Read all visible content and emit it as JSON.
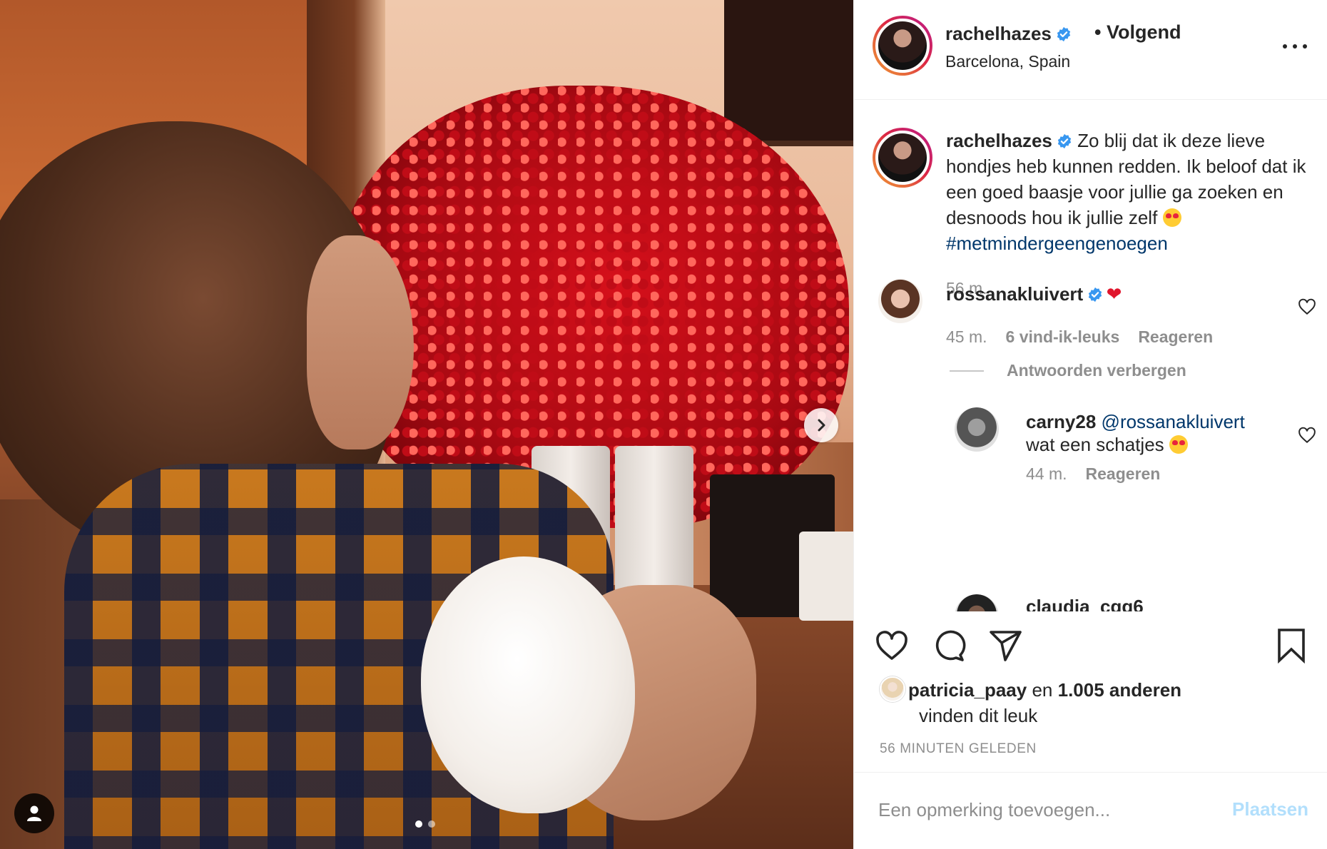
{
  "post": {
    "username": "rachelhazes",
    "follow_status": "• Volgend",
    "location": "Barcelona, Spain",
    "caption": "Zo blij dat ik deze lieve hondjes heb kunnen redden. Ik beloof dat ik een goed baasje voor jullie ga zoeken en desnoods hou ik jullie zelf",
    "hashtag": "#metmindergeengenoegen",
    "caption_time": "56 m."
  },
  "carousel": {
    "active_index": 1,
    "total": 2
  },
  "comments": [
    {
      "username": "rossanakluivert",
      "verified": true,
      "time": "45 m.",
      "likes": "6 vind-ik-leuks",
      "reply": "Reageren"
    },
    {
      "username": "carny28",
      "mention": "@rossanakluivert",
      "text": "wat een schatjes",
      "time": "44 m.",
      "reply": "Reageren"
    },
    {
      "username": "claudia_cgg6"
    }
  ],
  "hide_replies_label": "Antwoorden verbergen",
  "likes": {
    "user": "patricia_paay",
    "connector": "en",
    "others": "1.005 anderen",
    "suffix": "vinden dit leuk"
  },
  "posted_label": "56 MINUTEN GELEDEN",
  "comment_input": {
    "placeholder": "Een opmerking toevoegen...",
    "post_label": "Plaatsen"
  },
  "colors": {
    "link": "#00376b",
    "muted": "#8e8e8e",
    "verified": "#3897f0",
    "post_disabled": "#b2dffc"
  },
  "icons": [
    "more-icon",
    "verified-icon",
    "heart-icon",
    "comment-icon",
    "share-icon",
    "bookmark-icon",
    "next-arrow-icon",
    "user-tag-icon"
  ]
}
